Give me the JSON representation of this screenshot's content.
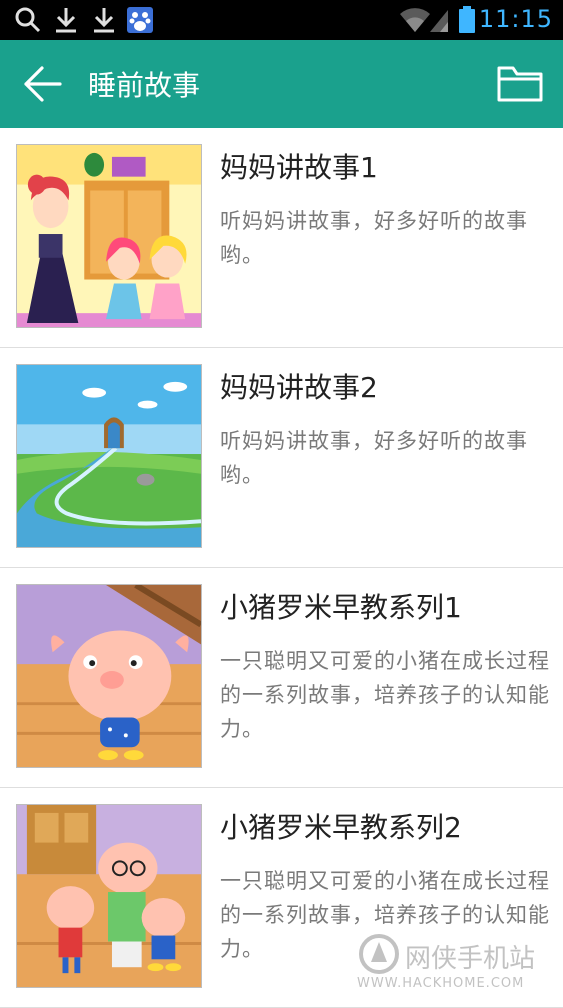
{
  "status_bar": {
    "time": "11:15",
    "icons": [
      "search-icon",
      "download-icon",
      "download-icon",
      "baidu-icon",
      "wifi-icon",
      "signal-icon",
      "battery-icon"
    ]
  },
  "app_bar": {
    "title": "睡前故事",
    "back_icon": "arrow-left-icon",
    "action_icon": "folder-icon",
    "color": "#1aa18d"
  },
  "stories": [
    {
      "title": "妈妈讲故事1",
      "description": "听妈妈讲故事，好多好听的故事哟。"
    },
    {
      "title": "妈妈讲故事2",
      "description": "听妈妈讲故事，好多好听的故事哟。"
    },
    {
      "title": "小猪罗米早教系列1",
      "description": "一只聪明又可爱的小猪在成长过程的一系列故事，培养孩子的认知能力。"
    },
    {
      "title": "小猪罗米早教系列2",
      "description": "一只聪明又可爱的小猪在成长过程的一系列故事，培养孩子的认知能力。"
    }
  ],
  "watermark": {
    "text": "网侠手机站",
    "url": "WWW.HACKHOME.COM"
  }
}
